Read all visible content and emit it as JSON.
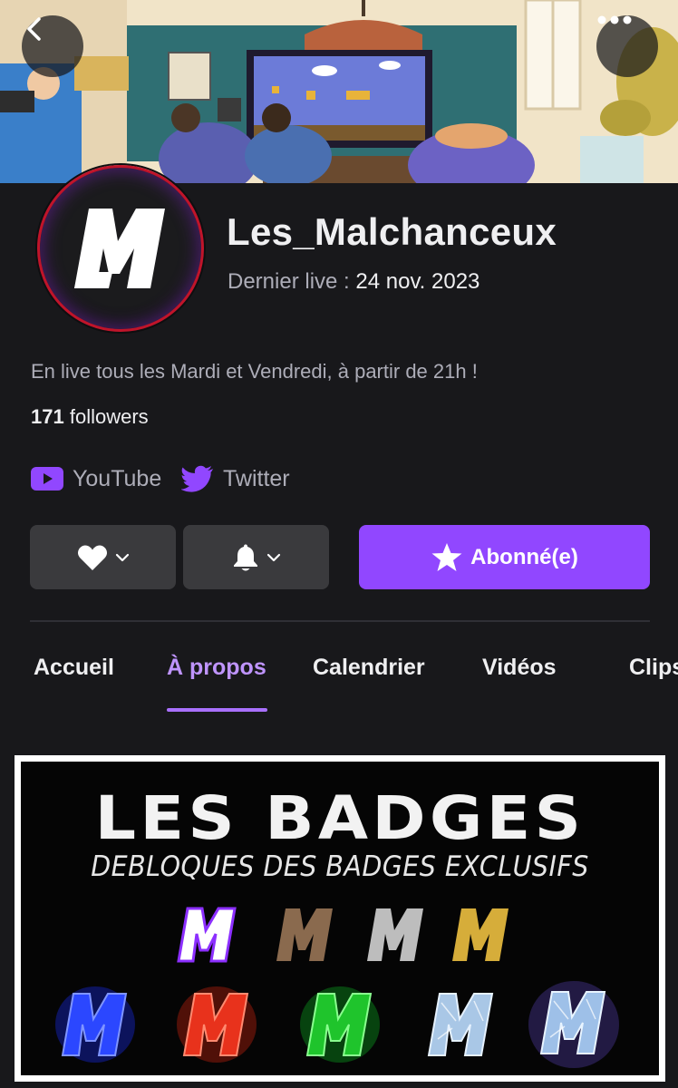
{
  "channel": {
    "name": "Les_Malchanceux",
    "last_live_label": "Dernier live :",
    "last_live_date": "24 nov. 2023",
    "bio": "En live tous les Mardi et Vendredi, à partir de 21h !",
    "followers_count": "171",
    "followers_label": "followers"
  },
  "social": [
    {
      "label": "YouTube",
      "icon": "youtube-icon"
    },
    {
      "label": "Twitter",
      "icon": "twitter-icon"
    }
  ],
  "actions": {
    "follow_icon": "heart-icon",
    "notify_icon": "bell-icon",
    "subscribed_label": "Abonné(e)"
  },
  "tabs": [
    {
      "label": "Accueil",
      "active": false
    },
    {
      "label": "À propos",
      "active": true
    },
    {
      "label": "Calendrier",
      "active": false
    },
    {
      "label": "Vidéos",
      "active": false
    },
    {
      "label": "Clips",
      "active": false
    }
  ],
  "panel": {
    "title": "LES BADGES",
    "subtitle": "DEBLOQUES DES BADGES EXCLUSIFS"
  },
  "colors": {
    "background": "#18181b",
    "accent": "#9147ff",
    "accent_text": "#bf94ff",
    "button_gray": "#3a3a3d",
    "avatar_ring": "#c0142a"
  }
}
